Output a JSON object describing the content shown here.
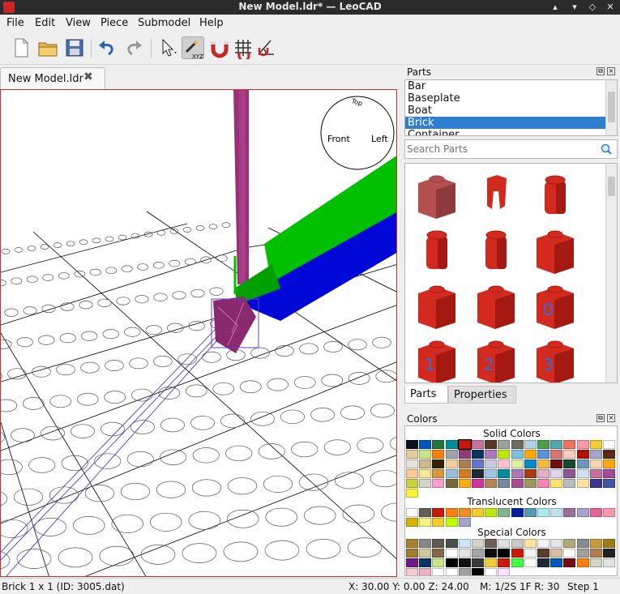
{
  "window": {
    "title": "New Model.ldr* — LeoCAD"
  },
  "menu": [
    "File",
    "Edit",
    "View",
    "Piece",
    "Submodel",
    "Help"
  ],
  "toolbar": {
    "icons": [
      "new-file-icon",
      "open-folder-icon",
      "save-icon",
      "undo-icon",
      "redo-icon",
      "select-arrow-icon",
      "transform-wand-icon",
      "snap-grid-icon",
      "snap-magnet-icon",
      "angle-snap-icon"
    ],
    "xyz_label": "XYZ"
  },
  "tab": {
    "label": "New Model.ldr",
    "close": "✖"
  },
  "viewcube": {
    "front": "Front",
    "left": "Left",
    "top": "Top"
  },
  "parts_panel": {
    "title": "Parts",
    "categories": [
      "Bar",
      "Baseplate",
      "Boat",
      "Brick",
      "Container"
    ],
    "selected_index": 3,
    "search_placeholder": "Search Parts",
    "tiles": [
      {
        "label": ""
      },
      {
        "label": ""
      },
      {
        "label": ""
      },
      {
        "label": ""
      },
      {
        "label": ""
      },
      {
        "label": ""
      },
      {
        "label": ""
      },
      {
        "label": ""
      },
      {
        "label": "0"
      },
      {
        "label": "1"
      },
      {
        "label": "2"
      },
      {
        "label": "3"
      }
    ],
    "tabs": [
      "Parts",
      "Properties"
    ],
    "active_tab": 0
  },
  "colors_panel": {
    "title": "Colors",
    "solid_title": "Solid Colors",
    "translucent_title": "Translucent Colors",
    "special_title": "Special Colors",
    "solid": [
      "#05131d",
      "#0055bf",
      "#237841",
      "#008f9b",
      "#c91a09",
      "#c870a0",
      "#583927",
      "#9ba19d",
      "#6d6e5c",
      "#b4d2e3",
      "#4b9f4a",
      "#55a5af",
      "#f2705e",
      "#fc97ac",
      "#f2cd37",
      "#ffffff",
      "#e4cd9e",
      "#c9e788",
      "#ff800d",
      "#a0a5a9",
      "#923978",
      "#0a3463",
      "#ac78ba",
      "#bbe90b",
      "#7dbfdd",
      "#ffa70b",
      "#5a93db",
      "#d67572",
      "#feccb9",
      "#b31004",
      "#a5a5cb",
      "#5b2a15",
      "#e6e3da",
      "#ccb98d",
      "#352100",
      "#f3cf9b",
      "#aa7d55",
      "#6874ca",
      "#c9cae2",
      "#fec3ce",
      "#dfeea5",
      "#078bc9",
      "#f8bb3d",
      "#720e0f",
      "#184632",
      "#6c96bf",
      "#f6d7b3",
      "#ffa70b",
      "#ffc995",
      "#fbe696",
      "#dd983c",
      "#94c2dc",
      "#d67923",
      "#1b2a34",
      "#9fc3e9",
      "#068d9b",
      "#ac78ba",
      "#a83d15",
      "#e4adc8",
      "#e1d5ed",
      "#8e5597",
      "#cfe2f7",
      "#c870a0",
      "#a5499c",
      "#c7d23c",
      "#d4d5c9",
      "#ff9ecd",
      "#726b36",
      "#fbab18",
      "#d3359d",
      "#b48455",
      "#7988a1",
      "#aa4d8e",
      "#9b9a5a",
      "#f785b1",
      "#ffe371",
      "#bbbdbc",
      "#ffe2a0",
      "#3f3691",
      "#4354a3",
      "#fff03a"
    ],
    "translucent": [
      "#fcfcfc",
      "#635f52",
      "#c91a09",
      "#ff800d",
      "#f08f1c",
      "#f5cd2f",
      "#bbe90b",
      "#84b68d",
      "#0020a0",
      "#559ab7",
      "#aee9ef",
      "#c1dff0",
      "#96709f",
      "#a5a5cb",
      "#df6695",
      "#fc97ac",
      "#dab000",
      "#f8f184",
      "#f5cd2f",
      "#c0ff00",
      "#a5a5cb"
    ],
    "special": [
      "#aa7f2e",
      "#898788",
      "#5e5a4e",
      "#4b4f4e",
      "#cce6ff",
      "#d4d5c9",
      "#6c5f5b",
      "#e1e1e1",
      "#c9c9c9",
      "#ffe2a0",
      "#f4f4f4",
      "#e5e5e5",
      "#b3a77d",
      "#8c8c8c",
      "#c89a3a",
      "#9e7d1f",
      "#a07d2e",
      "#d0c8a0",
      "#83684a",
      "#ffffff",
      "#e6e6e6",
      "#a5a5a5",
      "#0d0d0d",
      "#000000",
      "#c91a09",
      "#f2f2f2",
      "#5a3c2a",
      "#d8c0a0",
      "#ffffff",
      "#a0a0a0",
      "#b67b50",
      "#222222",
      "#6b1a8c",
      "#0a3463",
      "#c9e788",
      "#000000",
      "#101010",
      "#3a3a3a",
      "#f2cd37",
      "#c91a09",
      "#40ff40",
      "#ffffff",
      "#1b2a34",
      "#0055bf",
      "#720e0f",
      "#ff800d",
      "#d4d5c9",
      "#e4e4e4",
      "#f8c8d0",
      "#f0b0c0",
      "#ffffff",
      "#ffffff",
      "#a0a0a0",
      "#000000",
      "#ffffff",
      "#ffe0ff"
    ]
  },
  "statusbar": {
    "piece": "Brick  1 x  1 (ID: 3005.dat)",
    "coords": "X: 30.00 Y: 0.00 Z: 24.00",
    "mode": "M: 1/2S 1F R: 30",
    "step": "Step 1"
  },
  "scene_colors": {
    "green": "#00c000",
    "blue": "#0008d8",
    "magenta": "#9a2f7a",
    "purple_piece": "#8a2a6e"
  }
}
